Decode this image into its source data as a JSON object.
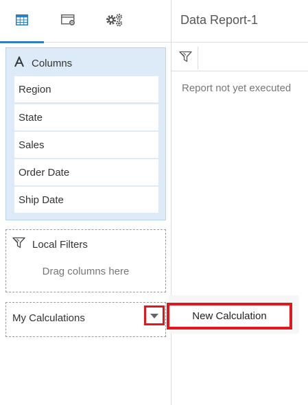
{
  "tabs": [
    {
      "icon": "table-icon",
      "active": true
    },
    {
      "icon": "data-settings-icon",
      "active": false
    },
    {
      "icon": "gears-icon",
      "active": false
    }
  ],
  "columns": {
    "title": "Columns",
    "icon": "text-a-icon",
    "items": [
      {
        "label": "Region"
      },
      {
        "label": "State"
      },
      {
        "label": "Sales"
      },
      {
        "label": "Order Date"
      },
      {
        "label": "Ship Date"
      }
    ]
  },
  "local_filters": {
    "title": "Local Filters",
    "icon": "filter-icon",
    "placeholder": "Drag columns here"
  },
  "calculations": {
    "title": "My Calculations",
    "dropdown_icon": "caret-down-icon"
  },
  "report": {
    "title": "Data Report-1",
    "status": "Report not yet executed",
    "filter_icon": "filter-icon"
  },
  "menu": {
    "new_calculation": "New Calculation"
  },
  "colors": {
    "accent": "#2d7fc1",
    "columns_bg": "#dcebf7",
    "highlight": "#e4161b"
  }
}
